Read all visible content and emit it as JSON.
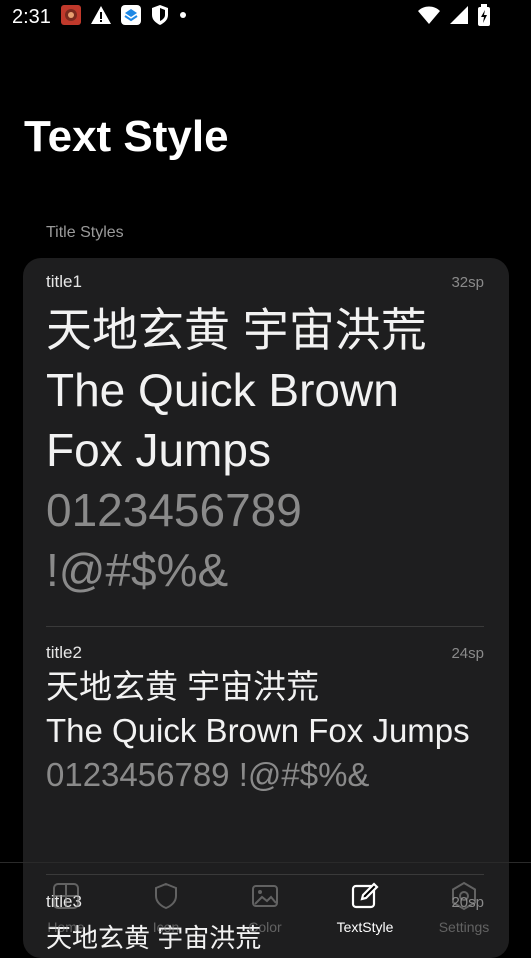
{
  "status_bar": {
    "time": "2:31",
    "left_icons": [
      "app-notification-icon",
      "warning-icon",
      "app-badge-icon",
      "shield-icon",
      "dot-icon"
    ],
    "right_icons": [
      "wifi-icon",
      "signal-icon",
      "battery-charging-icon"
    ]
  },
  "page": {
    "title": "Text Style"
  },
  "section": {
    "label": "Title Styles"
  },
  "styles": [
    {
      "name": "title1",
      "size": "32sp",
      "cjk": "天地玄黄 宇宙洪荒",
      "latin": "The Quick Brown Fox Jumps",
      "digits": "0123456789 !@#$%&"
    },
    {
      "name": "title2",
      "size": "24sp",
      "cjk": "天地玄黄 宇宙洪荒",
      "latin": "The Quick Brown Fox Jumps",
      "digits": "0123456789 !@#$%&"
    },
    {
      "name": "title3",
      "size": "20sp",
      "cjk": "天地玄黄 宇宙洪荒"
    }
  ],
  "nav": {
    "items": [
      {
        "label": "Home",
        "icon": "home-grid-icon"
      },
      {
        "label": "Icon",
        "icon": "shield-icon"
      },
      {
        "label": "Color",
        "icon": "image-icon"
      },
      {
        "label": "TextStyle",
        "icon": "edit-icon",
        "active": true
      },
      {
        "label": "Settings",
        "icon": "hexagon-settings-icon"
      }
    ]
  },
  "colors": {
    "background": "#000000",
    "card": "#1e1e1f",
    "secondary_text": "#8a8a8a"
  }
}
